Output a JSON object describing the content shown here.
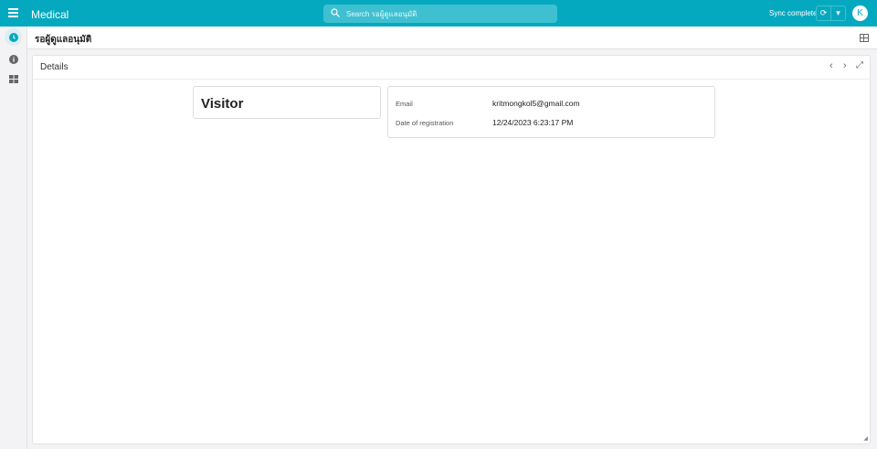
{
  "topbar": {
    "app_title": "Medical",
    "search_placeholder": "Search รอผู้ดูแลอนุมัติ",
    "sync_status": "Sync complete",
    "avatar_initial": "K"
  },
  "header": {
    "title": "รอผู้ดูแลอนุมัติ"
  },
  "panel": {
    "title": "Details",
    "card_title": "Visitor",
    "fields": [
      {
        "label": "Email",
        "value": "kritmongkol5@gmail.com"
      },
      {
        "label": "Date of registration",
        "value": "12/24/2023 6:23:17 PM"
      }
    ]
  },
  "colors": {
    "accent": "#05a9bf"
  }
}
